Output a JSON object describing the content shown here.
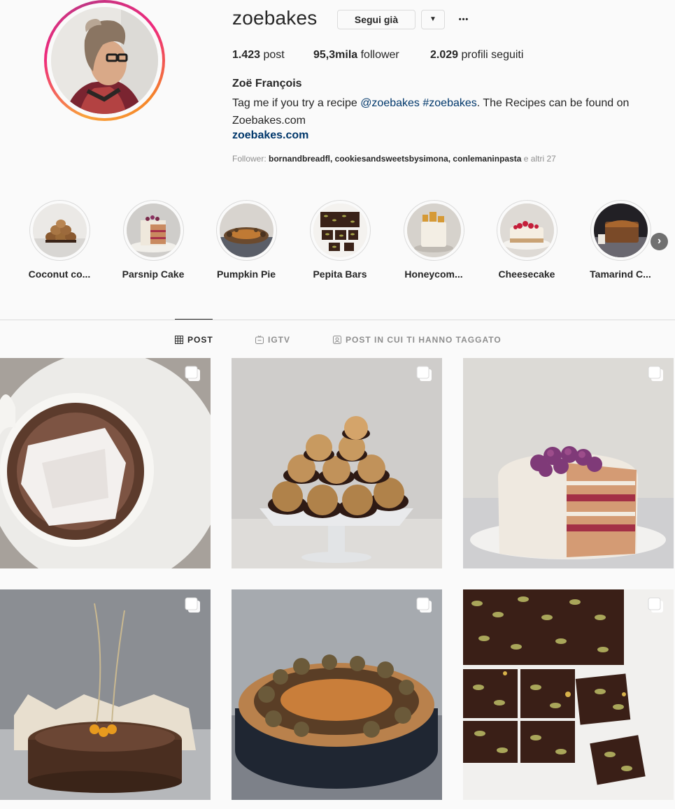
{
  "profile": {
    "username": "zoebakes",
    "follow_label": "Segui già",
    "dropdown_glyph": "▼",
    "more_glyph": "•••",
    "stats": {
      "posts_count": "1.423",
      "posts_label": "post",
      "followers_count": "95,3mila",
      "followers_label": "follower",
      "following_count": "2.029",
      "following_label": "profili seguiti"
    },
    "full_name": "Zoë François",
    "bio": {
      "prefix": "Tag me if you try a recipe ",
      "mention": "@zoebakes",
      "space": " ",
      "hashtag": "#zoebakes",
      "suffix": ". The Recipes can be found on Zoebakes.com"
    },
    "website": "zoebakes.com",
    "followed_by": {
      "label": "Follower: ",
      "names": "bornandbreadfl, cookiesandsweetsbysimona, conlemaninpasta",
      "others": " e altri 27"
    }
  },
  "highlights": [
    {
      "label": "Coconut co...",
      "icon": "coconut-cookies-thumb"
    },
    {
      "label": "Parsnip Cake",
      "icon": "parsnip-cake-thumb"
    },
    {
      "label": "Pumpkin Pie",
      "icon": "pumpkin-pie-thumb"
    },
    {
      "label": "Pepita Bars",
      "icon": "pepita-bars-thumb"
    },
    {
      "label": "Honeycom...",
      "icon": "honeycomb-cake-thumb"
    },
    {
      "label": "Cheesecake",
      "icon": "cheesecake-thumb"
    },
    {
      "label": "Tamarind C...",
      "icon": "tamarind-cake-thumb"
    }
  ],
  "highlights_next_glyph": "›",
  "tabs": [
    {
      "label": "POST",
      "icon": "grid-icon",
      "active": true
    },
    {
      "label": "IGTV",
      "icon": "igtv-icon",
      "active": false
    },
    {
      "label": "POST IN CUI TI HANNO TAGGATO",
      "icon": "tagged-icon",
      "active": false
    }
  ],
  "posts": [
    {
      "subject": "hot-chocolate-marshmallow",
      "multiple": true
    },
    {
      "subject": "coconut-macaroons-stand",
      "multiple": true
    },
    {
      "subject": "cranberry-layer-cake",
      "multiple": true
    },
    {
      "subject": "chocolate-cake-sugar-spun",
      "multiple": true
    },
    {
      "subject": "pumpkin-pie",
      "multiple": true
    },
    {
      "subject": "pepita-chocolate-bars",
      "multiple": true
    }
  ],
  "colors": {
    "link": "#00376b",
    "text": "#262626",
    "muted": "#8e8e8e",
    "border": "#dbdbdb",
    "background": "#fafafa"
  }
}
